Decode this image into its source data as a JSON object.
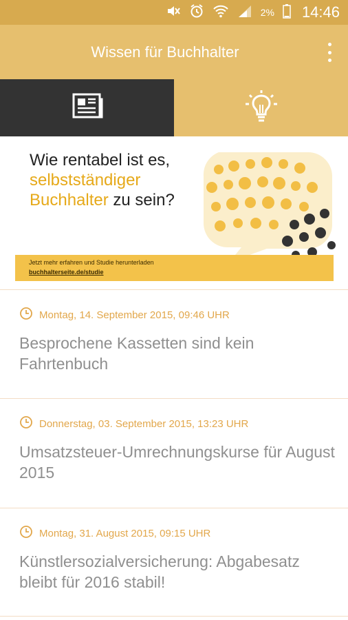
{
  "status_bar": {
    "battery_percent": "2%",
    "time": "14:46",
    "icons": [
      "mute-icon",
      "alarm-icon",
      "wifi-icon",
      "signal-icon",
      "battery-icon"
    ]
  },
  "app_bar": {
    "title": "Wissen für Buchhalter",
    "menu_icon": "overflow-menu-icon"
  },
  "tabs": [
    {
      "name": "news",
      "icon": "newspaper-icon",
      "selected": true
    },
    {
      "name": "tips",
      "icon": "lightbulb-icon",
      "selected": false
    }
  ],
  "banner": {
    "line1": "Wie rentabel ist es,",
    "line2_accent": "selbstständiger",
    "line3_accent": "Buchhalter",
    "line3_rest": " zu sein?",
    "strip_text": "Jetzt mehr erfahren und Studie herunterladen",
    "strip_link": "buchhalterseite.de/studie"
  },
  "articles": [
    {
      "date": "Montag, 14. September 2015, 09:46 UHR",
      "title": "Besprochene Kassetten sind kein Fahrtenbuch"
    },
    {
      "date": "Donnerstag, 03. September 2015, 13:23 UHR",
      "title": "Umsatzsteuer-Umrechnungskurse für August 2015"
    },
    {
      "date": "Montag, 31. August 2015, 09:15 UHR",
      "title": "Künstlersozialversicherung: Abgabesatz bleibt für 2016 stabil!"
    }
  ],
  "colors": {
    "status_bar": "#d7aa4f",
    "app_bar": "#e6bf6e",
    "tab_selected": "#333333",
    "accent": "#e2a74b",
    "headline_text": "#8f8f8f"
  }
}
